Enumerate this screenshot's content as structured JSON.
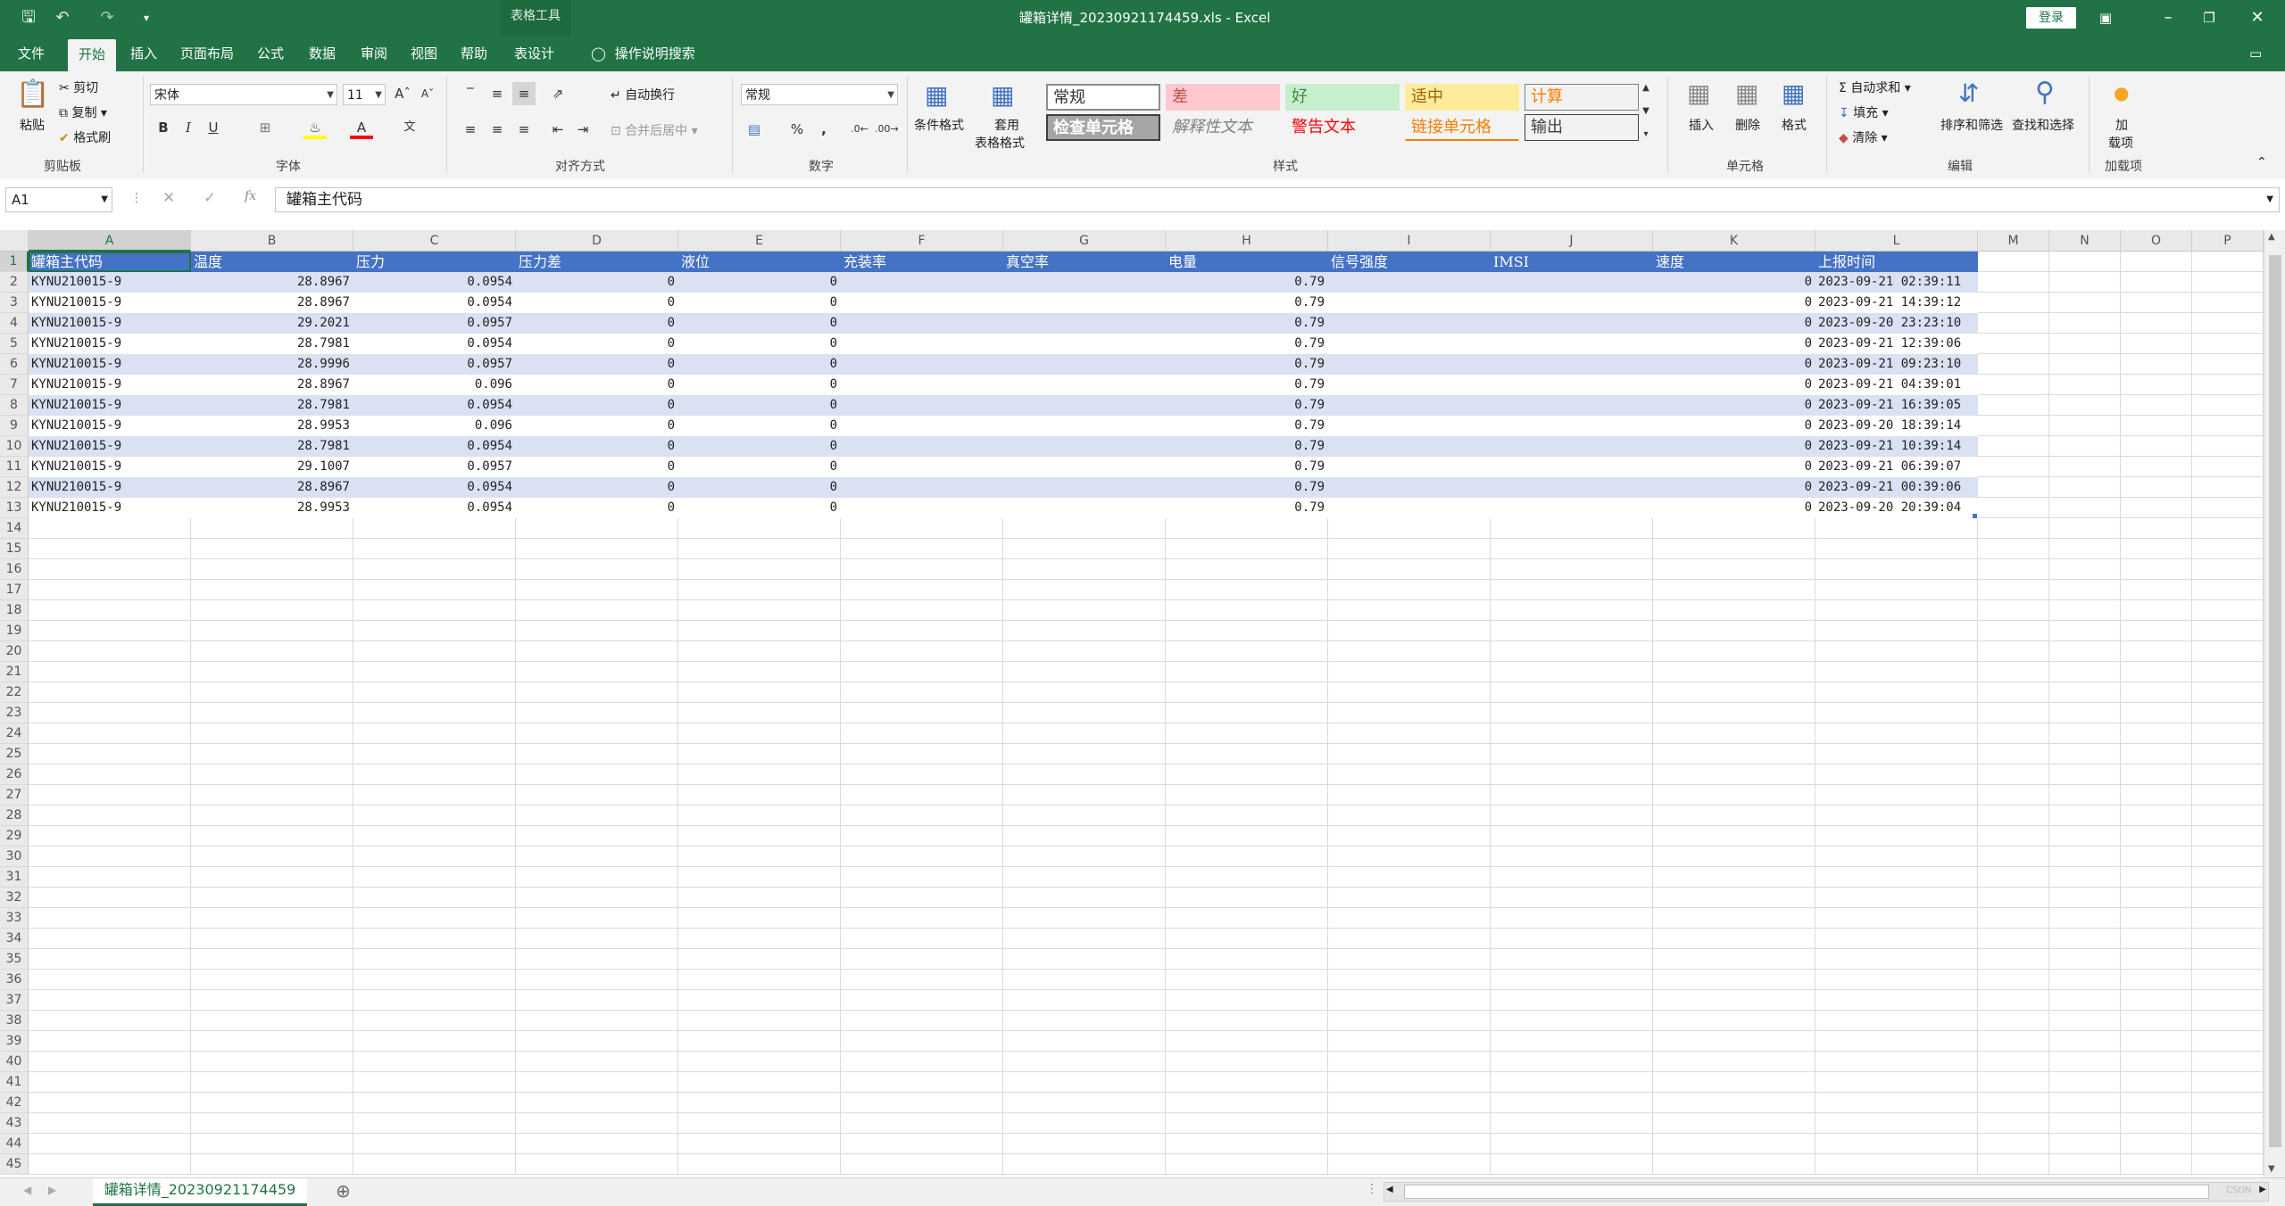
{
  "window": {
    "title": "罐箱详情_20230921174459.xls - Excel",
    "context_tools": "表格工具",
    "login": "登录"
  },
  "tabs": [
    "文件",
    "开始",
    "插入",
    "页面布局",
    "公式",
    "数据",
    "审阅",
    "视图",
    "帮助",
    "表设计"
  ],
  "tell_me": "操作说明搜索",
  "ribbon": {
    "clipboard": {
      "paste": "粘贴",
      "cut": "剪切",
      "copy": "复制",
      "painter": "格式刷",
      "label": "剪贴板"
    },
    "font": {
      "name": "宋体",
      "size": "11",
      "label": "字体"
    },
    "align": {
      "wrap": "自动换行",
      "merge": "合并后居中",
      "label": "对齐方式"
    },
    "number": {
      "format": "常规",
      "label": "数字"
    },
    "styles": {
      "cond_format": "条件格式",
      "table_format_1": "套用",
      "table_format_2": "表格格式",
      "items": [
        {
          "text": "常规",
          "bg": "#ffffff",
          "fg": "#333333",
          "border": "#8c8c8c"
        },
        {
          "text": "差",
          "bg": "#ffc7ce",
          "fg": "#c0504d",
          "border": "#ffc7ce"
        },
        {
          "text": "好",
          "bg": "#c6efce",
          "fg": "#3d8a3f",
          "border": "#c6efce"
        },
        {
          "text": "适中",
          "bg": "#ffeb9c",
          "fg": "#9c6500",
          "border": "#ffeb9c"
        },
        {
          "text": "计算",
          "bg": "#f2f2f2",
          "fg": "#fa7d00",
          "border": "#7f7f7f"
        },
        {
          "text": "检查单元格",
          "bg": "#a5a5a5",
          "fg": "#ffffff",
          "border": "#3f3f3f"
        },
        {
          "text": "解释性文本",
          "bg": "#f3f3f3",
          "fg": "#7f7f7f",
          "border": "#f3f3f3"
        },
        {
          "text": "警告文本",
          "bg": "#f3f3f3",
          "fg": "#ff0000",
          "border": "#f3f3f3"
        },
        {
          "text": "链接单元格",
          "bg": "#f3f3f3",
          "fg": "#fa7d00",
          "border": "#f3f3f3"
        },
        {
          "text": "输出",
          "bg": "#f2f2f2",
          "fg": "#3f3f3f",
          "border": "#3f3f3f"
        }
      ],
      "label": "样式"
    },
    "cells": {
      "insert": "插入",
      "delete": "删除",
      "format": "格式",
      "label": "单元格"
    },
    "editing": {
      "autosum": "自动求和",
      "fill": "填充",
      "clear": "清除",
      "sort": "排序和筛选",
      "find": "查找和选择",
      "label": "编辑"
    },
    "addins": {
      "line1": "加",
      "line2": "载项",
      "label": "加载项"
    }
  },
  "formula_bar": {
    "name_box": "A1",
    "fx": "fx",
    "content": "罐箱主代码"
  },
  "columns": [
    "A",
    "B",
    "C",
    "D",
    "E",
    "F",
    "G",
    "H",
    "I",
    "J",
    "K",
    "L",
    "M",
    "N",
    "O",
    "P"
  ],
  "headers": [
    "罐箱主代码",
    "温度",
    "压力",
    "压力差",
    "液位",
    "充装率",
    "真空率",
    "电量",
    "信号强度",
    "IMSI",
    "速度",
    "上报时间"
  ],
  "rows": [
    [
      "KYNU210015-9",
      "28.8967",
      "0.0954",
      "0",
      "0",
      "",
      "",
      "0.79",
      "",
      "",
      "0",
      "2023-09-21 02:39:11"
    ],
    [
      "KYNU210015-9",
      "28.8967",
      "0.0954",
      "0",
      "0",
      "",
      "",
      "0.79",
      "",
      "",
      "0",
      "2023-09-21 14:39:12"
    ],
    [
      "KYNU210015-9",
      "29.2021",
      "0.0957",
      "0",
      "0",
      "",
      "",
      "0.79",
      "",
      "",
      "0",
      "2023-09-20 23:23:10"
    ],
    [
      "KYNU210015-9",
      "28.7981",
      "0.0954",
      "0",
      "0",
      "",
      "",
      "0.79",
      "",
      "",
      "0",
      "2023-09-21 12:39:06"
    ],
    [
      "KYNU210015-9",
      "28.9996",
      "0.0957",
      "0",
      "0",
      "",
      "",
      "0.79",
      "",
      "",
      "0",
      "2023-09-21 09:23:10"
    ],
    [
      "KYNU210015-9",
      "28.8967",
      "0.096",
      "0",
      "0",
      "",
      "",
      "0.79",
      "",
      "",
      "0",
      "2023-09-21 04:39:01"
    ],
    [
      "KYNU210015-9",
      "28.7981",
      "0.0954",
      "0",
      "0",
      "",
      "",
      "0.79",
      "",
      "",
      "0",
      "2023-09-21 16:39:05"
    ],
    [
      "KYNU210015-9",
      "28.9953",
      "0.096",
      "0",
      "0",
      "",
      "",
      "0.79",
      "",
      "",
      "0",
      "2023-09-20 18:39:14"
    ],
    [
      "KYNU210015-9",
      "28.7981",
      "0.0954",
      "0",
      "0",
      "",
      "",
      "0.79",
      "",
      "",
      "0",
      "2023-09-21 10:39:14"
    ],
    [
      "KYNU210015-9",
      "29.1007",
      "0.0957",
      "0",
      "0",
      "",
      "",
      "0.79",
      "",
      "",
      "0",
      "2023-09-21 06:39:07"
    ],
    [
      "KYNU210015-9",
      "28.8967",
      "0.0954",
      "0",
      "0",
      "",
      "",
      "0.79",
      "",
      "",
      "0",
      "2023-09-21 00:39:06"
    ],
    [
      "KYNU210015-9",
      "28.9953",
      "0.0954",
      "0",
      "0",
      "",
      "",
      "0.79",
      "",
      "",
      "0",
      "2023-09-20 20:39:04"
    ]
  ],
  "row_count": 45,
  "sheet_tab": "罐箱详情_20230921174459",
  "watermark": "CSDN"
}
